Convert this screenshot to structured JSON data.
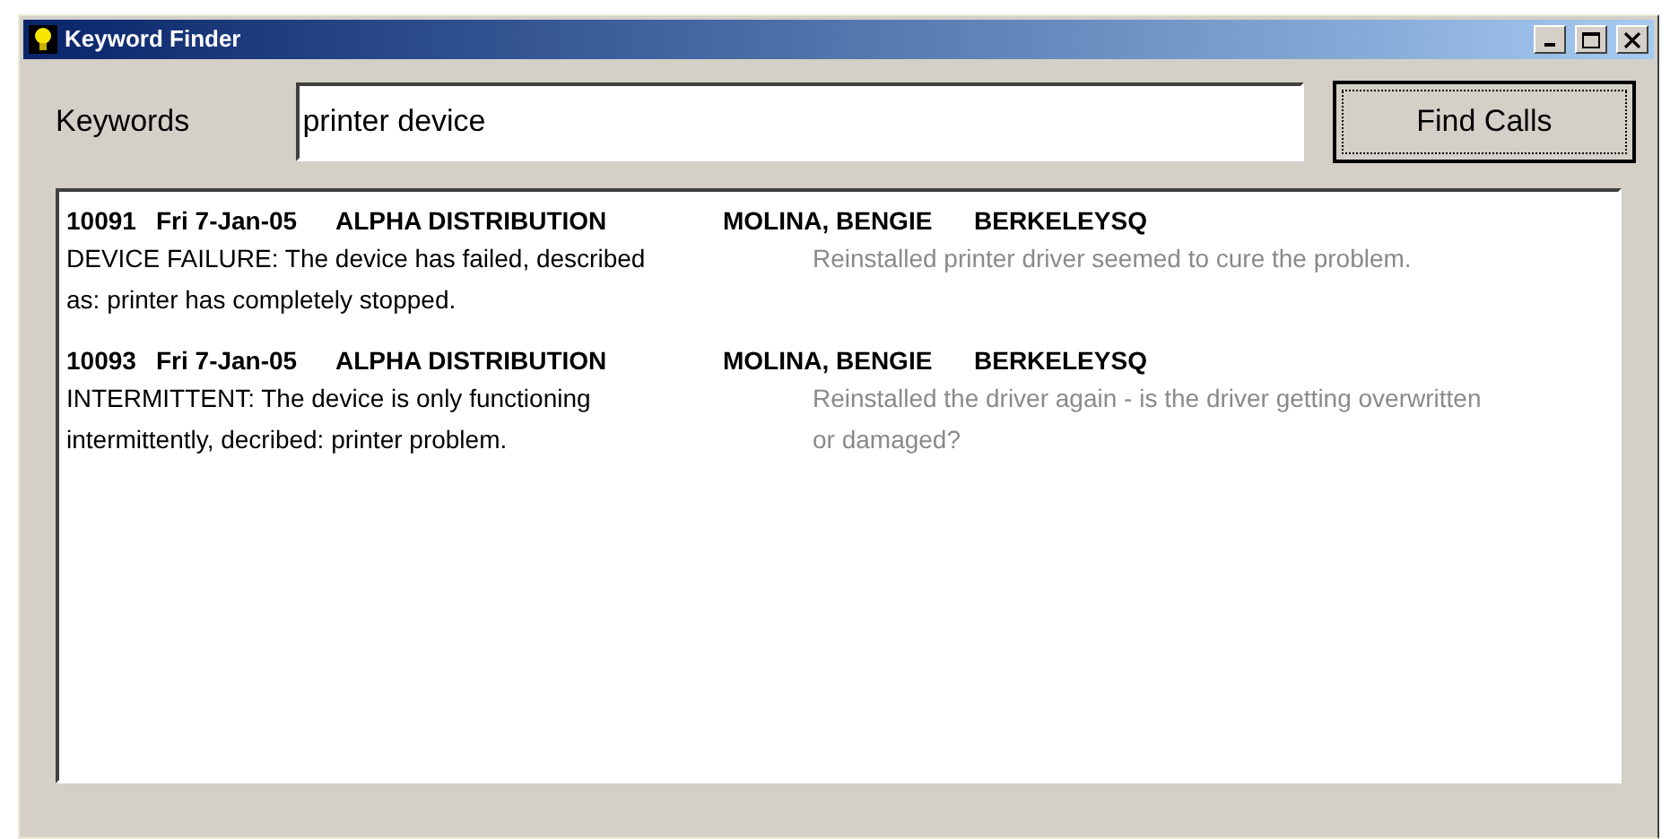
{
  "window": {
    "title": "Keyword Finder"
  },
  "search": {
    "label": "Keywords",
    "value": "printer device",
    "button": "Find Calls"
  },
  "calls": [
    {
      "id": "10091",
      "date": "Fri 7-Jan-05",
      "company": "ALPHA DISTRIBUTION",
      "agent": "MOLINA, BENGIE",
      "site": "BERKELEYSQ",
      "problem": "DEVICE FAILURE: The device has failed, described as: printer has completely stopped.",
      "resolution": "Reinstalled printer driver seemed to cure the problem."
    },
    {
      "id": "10093",
      "date": "Fri 7-Jan-05",
      "company": "ALPHA DISTRIBUTION",
      "agent": "MOLINA, BENGIE",
      "site": "BERKELEYSQ",
      "problem": "INTERMITTENT: The device is only functioning intermittently, decribed: printer problem.",
      "resolution": "Reinstalled the driver again - is the driver getting overwritten or damaged?"
    }
  ]
}
